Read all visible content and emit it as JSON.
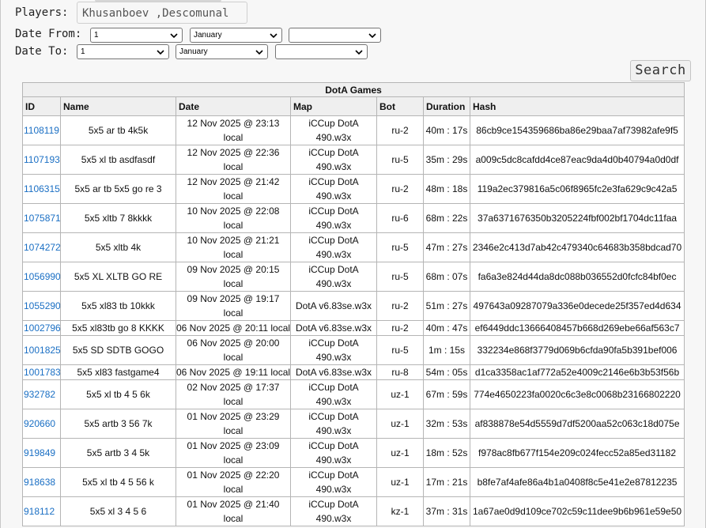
{
  "filters": {
    "players_label": "Players:",
    "players_value": "Khusanboev ,Descomunal",
    "date_from_label": "Date From:",
    "date_to_label": "Date To:",
    "from_day": "1",
    "from_month": "January",
    "from_year": "",
    "to_day": "1",
    "to_month": "January",
    "to_year": "",
    "search_label": "Search"
  },
  "table": {
    "title": "DotA Games",
    "columns": [
      "ID",
      "Name",
      "Date",
      "Map",
      "Bot",
      "Duration",
      "Hash"
    ],
    "rows": [
      {
        "id": "1108119",
        "name": "5x5 ar tb 4k5k",
        "date1": "12 Nov 2025 @ 23:13",
        "date2": "local",
        "map1": "iCCup DotA",
        "map2": "490.w3x",
        "bot": "ru-2",
        "duration": "40m : 17s",
        "hash": "86cb9ce154359686ba86e29baa7af73982afe9f5"
      },
      {
        "id": "1107193",
        "name": "5x5 xl tb asdfasdf",
        "date1": "12 Nov 2025 @ 22:36",
        "date2": "local",
        "map1": "iCCup DotA",
        "map2": "490.w3x",
        "bot": "ru-5",
        "duration": "35m : 29s",
        "hash": "a009c5dc8cafdd4ce87eac9da4d0b40794a0d0df"
      },
      {
        "id": "1106315",
        "name": "5x5 ar tb 5x5 go re 3",
        "date1": "12 Nov 2025 @ 21:42",
        "date2": "local",
        "map1": "iCCup DotA",
        "map2": "490.w3x",
        "bot": "ru-2",
        "duration": "48m : 18s",
        "hash": "119a2ec379816a5c06f8965fc2e3fa629c9c42a5"
      },
      {
        "id": "1075871",
        "name": "5x5 xltb 7 8kkkk",
        "date1": "10 Nov 2025 @ 22:08",
        "date2": "local",
        "map1": "iCCup DotA",
        "map2": "490.w3x",
        "bot": "ru-6",
        "duration": "68m : 22s",
        "hash": "37a6371676350b3205224fbf002bf1704dc11faa"
      },
      {
        "id": "1074272",
        "name": "5x5 xltb 4k",
        "date1": "10 Nov 2025 @ 21:21",
        "date2": "local",
        "map1": "iCCup DotA",
        "map2": "490.w3x",
        "bot": "ru-5",
        "duration": "47m : 27s",
        "hash": "2346e2c413d7ab42c479340c64683b358bdcad70"
      },
      {
        "id": "1056990",
        "name": "5x5 XL XLTB GO RE",
        "date1": "09 Nov 2025 @ 20:15",
        "date2": "local",
        "map1": "iCCup DotA",
        "map2": "490.w3x",
        "bot": "ru-5",
        "duration": "68m : 07s",
        "hash": "fa6a3e824d44da8dc088b036552d0fcfc84bf0ec"
      },
      {
        "id": "1055290",
        "name": "5x5 xl83 tb 10kkk",
        "date1": "09 Nov 2025 @ 19:17",
        "date2": "local",
        "map1": "DotA v6.83se.w3x",
        "map2": "",
        "bot": "ru-2",
        "duration": "51m : 27s",
        "hash": "497643a09287079a336e0decede25f357ed4d634"
      },
      {
        "id": "1002796",
        "name": "5x5 xl83tb go 8 KKKK",
        "date1": "06 Nov 2025 @ 20:11 local",
        "date2": "",
        "map1": "DotA v6.83se.w3x",
        "map2": "",
        "bot": "ru-2",
        "duration": "40m : 47s",
        "hash": "ef6449ddc13666408457b668d269ebe66af563c7"
      },
      {
        "id": "1001825",
        "name": "5x5 SD SDTB GOGO",
        "date1": "06 Nov 2025 @ 20:00",
        "date2": "local",
        "map1": "iCCup DotA",
        "map2": "490.w3x",
        "bot": "ru-5",
        "duration": "1m : 15s",
        "hash": "332234e868f3779d069b6cfda90fa5b391bef006"
      },
      {
        "id": "1001783",
        "name": "5x5 xl83 fastgame4",
        "date1": "06 Nov 2025 @ 19:11 local",
        "date2": "",
        "map1": "DotA v6.83se.w3x",
        "map2": "",
        "bot": "ru-8",
        "duration": "54m : 05s",
        "hash": "d1ca3358ac1af772a52e4009c2146e6b3b53f56b"
      },
      {
        "id": "932782",
        "name": "5x5 xl tb 4 5 6k",
        "date1": "02 Nov 2025 @ 17:37",
        "date2": "local",
        "map1": "iCCup DotA",
        "map2": "490.w3x",
        "bot": "uz-1",
        "duration": "67m : 59s",
        "hash": "774e4650223fa0020c6c3e8c0068b23166802220"
      },
      {
        "id": "920660",
        "name": "5x5 artb 3 56 7k",
        "date1": "01 Nov 2025 @ 23:29",
        "date2": "local",
        "map1": "iCCup DotA",
        "map2": "490.w3x",
        "bot": "uz-1",
        "duration": "32m : 53s",
        "hash": "af838878e54d5559d7df5200aa52c063c18d075e"
      },
      {
        "id": "919849",
        "name": "5x5 artb 3 4 5k",
        "date1": "01 Nov 2025 @ 23:09",
        "date2": "local",
        "map1": "iCCup DotA",
        "map2": "490.w3x",
        "bot": "uz-1",
        "duration": "18m : 52s",
        "hash": "f978ac8fb677f154e209c024fecc52a85ed31182"
      },
      {
        "id": "918638",
        "name": "5x5 xl tb 4 5 56 k",
        "date1": "01 Nov 2025 @ 22:20",
        "date2": "local",
        "map1": "iCCup DotA",
        "map2": "490.w3x",
        "bot": "uz-1",
        "duration": "17m : 21s",
        "hash": "b8fe7af4afe86a4b1a0408f8c5e41e2e87812235"
      },
      {
        "id": "918112",
        "name": "5x5 xl 3 4 5 6",
        "date1": "01 Nov 2025 @ 21:40",
        "date2": "local",
        "map1": "iCCup DotA",
        "map2": "490.w3x",
        "bot": "kz-1",
        "duration": "37m : 31s",
        "hash": "1a67ae0d9d109ce702c59c11dee9b6b961e59e50"
      }
    ]
  },
  "colors": {
    "link": "#1a6fc4",
    "border": "#b5b5b5",
    "header_bg": "#efefef",
    "page_bg": "#f7f7f7"
  }
}
